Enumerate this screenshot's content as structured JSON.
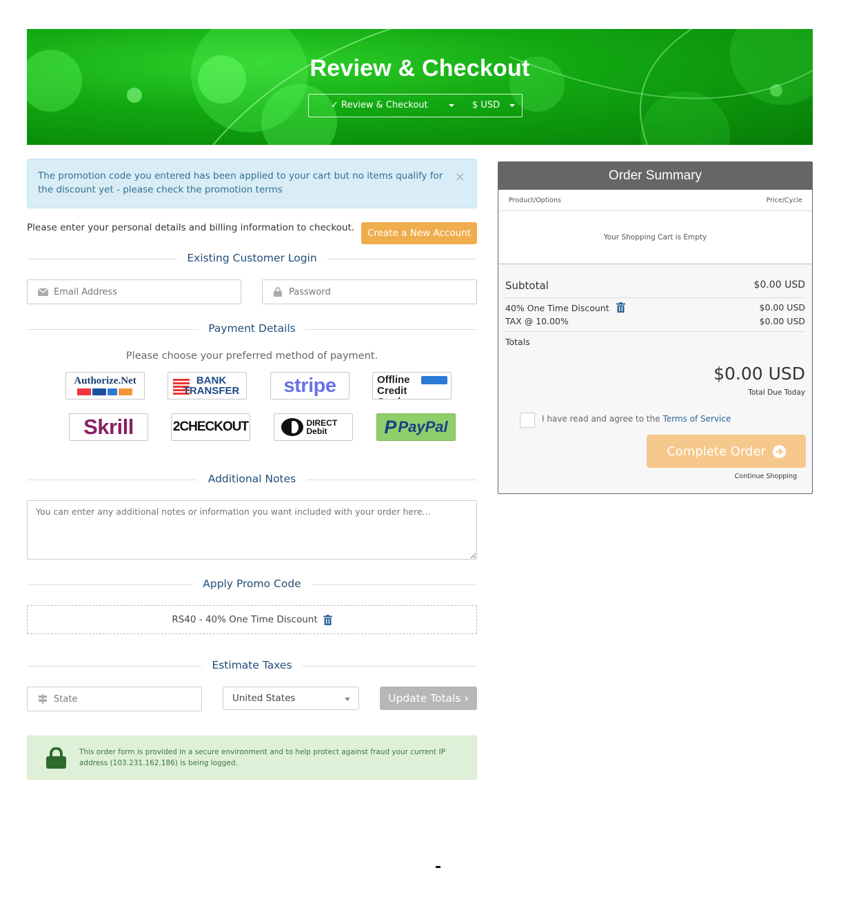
{
  "banner": {
    "title": "Review & Checkout",
    "nav_label": "✓ Review & Checkout",
    "currency_label": "$ USD",
    "colors": {
      "primary": "#12a812"
    }
  },
  "alert": {
    "message": "The promotion code you entered has been applied to your cart but no items qualify for the discount yet - please check the promotion terms",
    "close_glyph": "×"
  },
  "intro": {
    "text": "Please enter your personal details and billing information to checkout.",
    "create_account_label": "Create a New Account"
  },
  "login": {
    "heading": "Existing Customer Login",
    "email_placeholder": "Email Address",
    "password_placeholder": "Password"
  },
  "payment": {
    "heading": "Payment Details",
    "subtitle": "Please choose your preferred method of payment.",
    "methods": [
      {
        "name": "Authorize.Net",
        "icon": "authorize-net-logo"
      },
      {
        "name": "BANK TRANSFER",
        "icon": "bank-transfer-logo"
      },
      {
        "name": "stripe",
        "icon": "stripe-logo"
      },
      {
        "name": "Offline Credit Card",
        "icon": "offline-credit-card-logo"
      },
      {
        "name": "Skrill",
        "icon": "skrill-logo"
      },
      {
        "name": "2CHECKOUT",
        "icon": "2checkout-logo"
      },
      {
        "name": "DIRECT Debit",
        "icon": "direct-debit-logo"
      },
      {
        "name": "PayPal",
        "icon": "paypal-logo"
      }
    ]
  },
  "notes": {
    "heading": "Additional Notes",
    "placeholder": "You can enter any additional notes or information you want included with your order here..."
  },
  "promo": {
    "heading": "Apply Promo Code",
    "applied": "RS40 - 40% One Time Discount"
  },
  "taxes": {
    "heading": "Estimate Taxes",
    "state_placeholder": "State",
    "country": "United States",
    "update_label": "Update Totals"
  },
  "secure": {
    "text": "This order form is provided in a secure environment and to help protect against fraud your current IP address (103.231.162.186) is being logged."
  },
  "summary": {
    "title": "Order Summary",
    "col_product": "Product/Options",
    "col_price": "Price/Cycle",
    "empty": "Your Shopping Cart is Empty",
    "subtotal_label": "Subtotal",
    "subtotal_value": "$0.00 USD",
    "discount_label": "40% One Time Discount",
    "discount_value": "$0.00 USD",
    "tax_label": "TAX @ 10.00%",
    "tax_value": "$0.00 USD",
    "totals_label": "Totals",
    "total_value": "$0.00 USD",
    "total_caption": "Total Due Today",
    "tos_prefix": "I have read and agree to the",
    "tos_link": "Terms of Service",
    "complete_label": "Complete Order",
    "continue_label": "Continue Shopping"
  }
}
